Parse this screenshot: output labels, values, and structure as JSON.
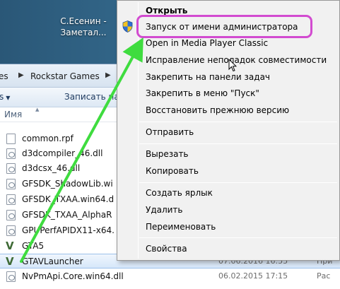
{
  "desktop": {
    "icon_label_line1": "С.Есенин -",
    "icon_label_line2": "Заметал..."
  },
  "explorer": {
    "breadcrumb": {
      "part1": "es",
      "part2": "Rockstar Games"
    },
    "toolbar": {
      "button1": "s",
      "button2": "Записать на оптически"
    },
    "column_name": "Имя",
    "files": [
      {
        "name": "common.rpf",
        "icon": "file",
        "date": "",
        "type": ""
      },
      {
        "name": "d3dcompiler_46.dll",
        "icon": "dll",
        "date": "",
        "type": ""
      },
      {
        "name": "d3dcsx_46.dll",
        "icon": "dll",
        "date": "",
        "type": ""
      },
      {
        "name": "GFSDK_ShadowLib.wi",
        "icon": "dll",
        "date": "",
        "type": ""
      },
      {
        "name": "GFSDK_TXAA.win64.d",
        "icon": "dll",
        "date": "",
        "type": ""
      },
      {
        "name": "GFSDK_TXAA_AlphaR",
        "icon": "dll",
        "date": "",
        "type": ""
      },
      {
        "name": "GPUPerfAPIDX11-x64.",
        "icon": "dll",
        "date": "",
        "type": ""
      },
      {
        "name": "GTA5",
        "icon": "gta-v",
        "date": "",
        "type": ""
      },
      {
        "name": "GTAVLauncher",
        "icon": "gta-v",
        "date": "07.06.2016 16:55",
        "type": "При"
      },
      {
        "name": "NvPmApi.Core.win64.dll",
        "icon": "dll",
        "date": "06.02.2015 17:15",
        "type": "Рас"
      }
    ]
  },
  "context_menu": {
    "open": "Открыть",
    "run_as_admin": "Запуск от имени администратора",
    "open_media_player": "Open in Media Player Classic",
    "troubleshoot": "Исправление неполадок совместимости",
    "pin_taskbar": "Закрепить на панели задач",
    "pin_start": "Закрепить в меню \"Пуск\"",
    "restore_previous": "Восстановить прежнюю версию",
    "send_to": "Отправить",
    "cut": "Вырезать",
    "copy": "Копировать",
    "create_shortcut": "Создать ярлык",
    "delete": "Удалить",
    "rename": "Переименовать",
    "properties": "Свойства"
  },
  "colors": {
    "highlight": "#d24bd0",
    "arrow": "#3fdc3f",
    "shield_blue": "#2f6fd3",
    "shield_yellow": "#f2c21f"
  }
}
